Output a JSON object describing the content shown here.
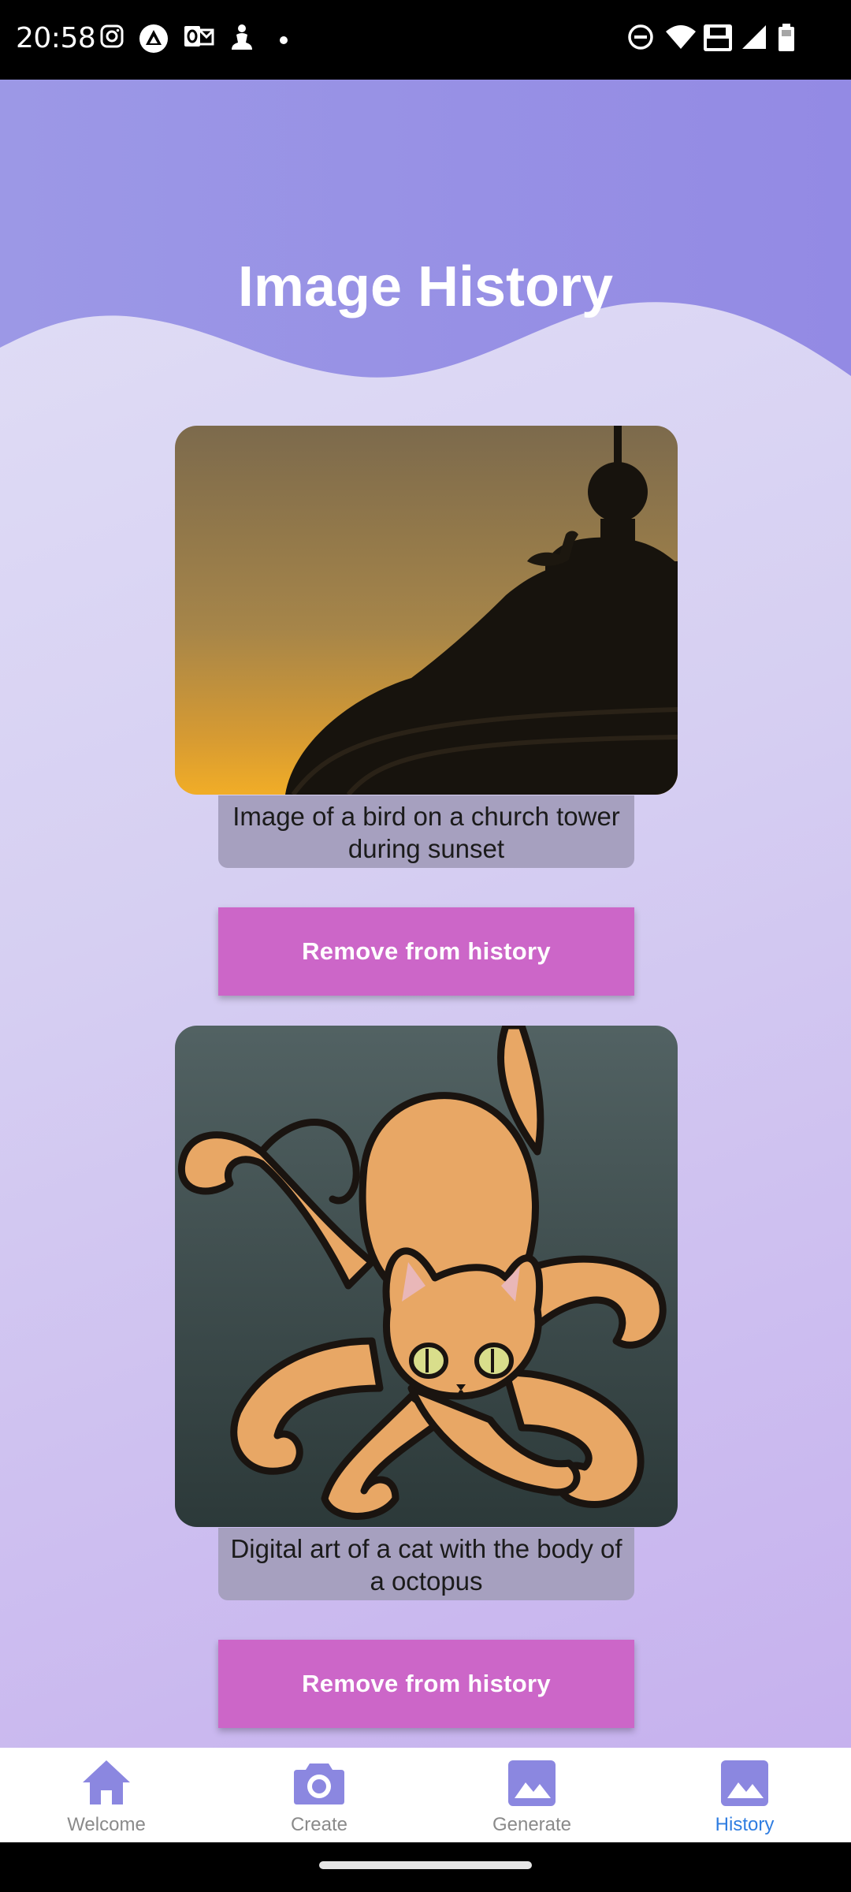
{
  "status_bar": {
    "time": "20:58",
    "left_icons": [
      "instagram-icon",
      "app-icon",
      "outlook-icon",
      "person-icon",
      "dot-icon"
    ],
    "right_icons": [
      "dnd-icon",
      "wifi-icon",
      "volte-icon",
      "signal-icon",
      "battery-icon"
    ]
  },
  "header": {
    "title": "Image History"
  },
  "colors": {
    "header_wave": "#948be4",
    "button": "#cc66c8",
    "caption_bg": "#a6a0bf",
    "nav_icon": "#8b87e0",
    "nav_active_label": "#2f7de1"
  },
  "history": [
    {
      "image": "bird-church-tower-sunset-image",
      "caption": "Image of a bird on a church tower during sunset",
      "button_label": "Remove from history"
    },
    {
      "image": "cat-octopus-art-image",
      "caption": "Digital art of a cat with the body of a octopus",
      "button_label": "Remove from history"
    }
  ],
  "nav": {
    "items": [
      {
        "label": "Welcome",
        "icon": "home-icon",
        "active": false
      },
      {
        "label": "Create",
        "icon": "camera-icon",
        "active": false
      },
      {
        "label": "Generate",
        "icon": "image-icon",
        "active": false
      },
      {
        "label": "History",
        "icon": "image-icon",
        "active": true
      }
    ]
  }
}
